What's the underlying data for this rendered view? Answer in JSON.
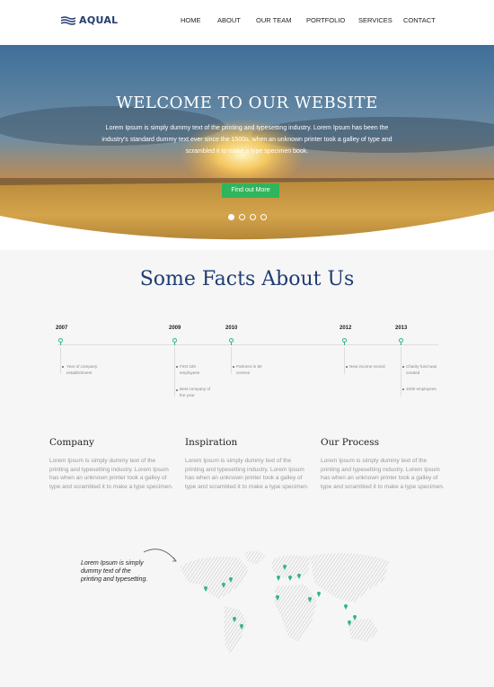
{
  "brand": {
    "name": "AQUAL",
    "color": "#243d72"
  },
  "nav": {
    "items": [
      {
        "label": "HOME"
      },
      {
        "label": "ABOUT"
      },
      {
        "label": "OUR TEAM"
      },
      {
        "label": "PORTFOLIO"
      },
      {
        "label": "SERVICES"
      },
      {
        "label": "CONTACT"
      }
    ]
  },
  "hero": {
    "title": "WELCOME TO OUR WEBSITE",
    "text": "Lorem Ipsum is simply dummy text of the printing and typesetting industry. Lorem Ipsum has been the industry's standard dummy text ever since the 1500s, when an unknown printer took a galley of type and scrambled it to make a type specimen book.",
    "button": "Find out More",
    "slides": 4,
    "active_slide": 1,
    "accent": "#2fb55b"
  },
  "facts": {
    "title": "Some Facts About Us",
    "timeline": [
      {
        "year": "2007",
        "notes": [
          "Year of company establishment"
        ]
      },
      {
        "year": "2009",
        "notes": [
          "First 100 employees",
          "Best company of the year"
        ]
      },
      {
        "year": "2010",
        "notes": [
          "Partners in 50 centres"
        ]
      },
      {
        "year": "2012",
        "notes": [
          "New income record"
        ]
      },
      {
        "year": "2013",
        "notes": [
          "Charity fund was created",
          "1000 employees"
        ]
      }
    ]
  },
  "columns": [
    {
      "title": "Company",
      "text": "Lorem Ipsum is simply dummy text of the printing and typesetting industry. Lorem Ipsum has when an unknown printer took a galley of type and scrambled it to make a type specimen."
    },
    {
      "title": "Inspiration",
      "text": "Lorem Ipsum is simply dummy text of the printing and typesetting industry. Lorem Ipsum has when an unknown printer took a galley of type and scrambled it to make a type specimen."
    },
    {
      "title": "Our Process",
      "text": "Lorem Ipsum is simply dummy text of the printing and typesetting industry. Lorem Ipsum has when an unknown printer took a galley of type and scrambled it to make a type specimen."
    }
  ],
  "map": {
    "quote": "Lorem Ipsum is simply dummy text of the printing and typesetting.",
    "marker_color": "#2fb58a",
    "map_icon": "world-map",
    "marker_icon": "map-pin-icon"
  }
}
